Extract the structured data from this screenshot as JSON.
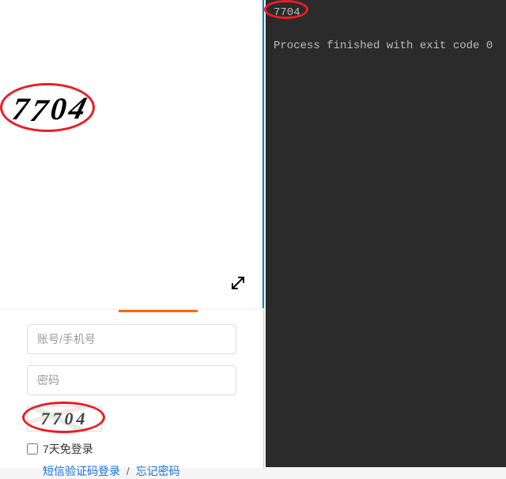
{
  "captcha": {
    "value": "7704",
    "d1": "7",
    "d2": "7",
    "d3": "0",
    "d4": "4"
  },
  "form": {
    "account_placeholder": "账号/手机号",
    "password_placeholder": "密码",
    "remember_label": "7天免登录",
    "sms_login_link": "短信验证码登录",
    "separator": "/",
    "forgot_password_link": "忘记密码"
  },
  "console": {
    "output_line_1": "7704",
    "output_line_2": "Process finished with exit code 0"
  },
  "icons": {
    "resize_arrow": "⤢"
  }
}
